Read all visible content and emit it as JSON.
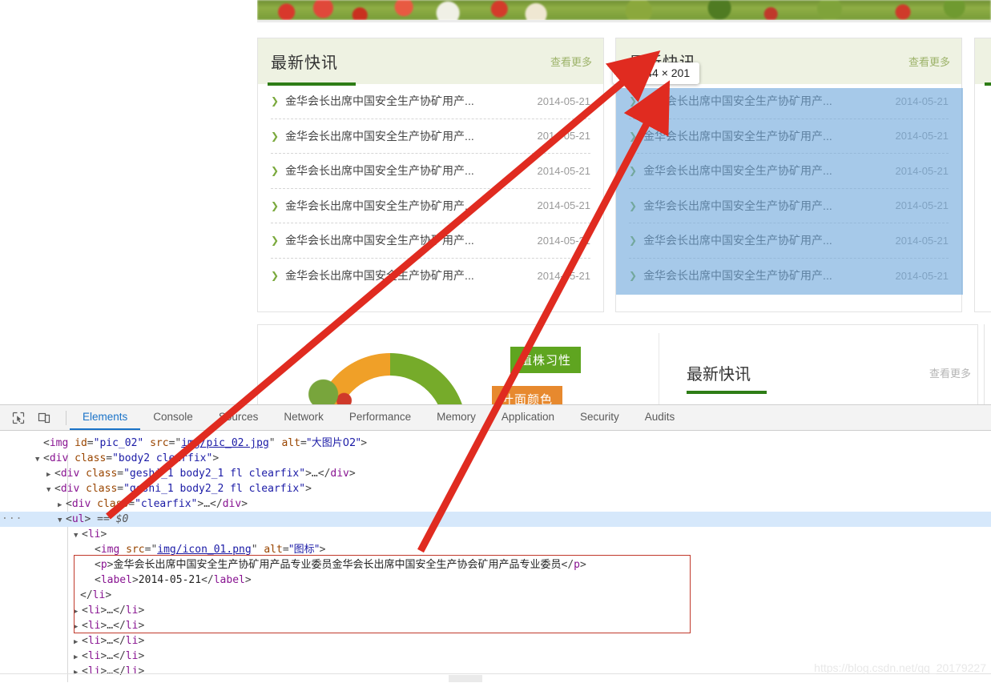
{
  "page": {
    "banner": {
      "alt": "大图片02"
    },
    "panels": [
      {
        "title": "最新快讯",
        "more": "查看更多",
        "rows": [
          {
            "text": "金华会长出席中国安全生产协矿用产...",
            "date": "2014-05-21"
          },
          {
            "text": "金华会长出席中国安全生产协矿用产...",
            "date": "2014-05-21"
          },
          {
            "text": "金华会长出席中国安全生产协矿用产...",
            "date": "2014-05-21"
          },
          {
            "text": "金华会长出席中国安全生产协矿用产...",
            "date": "2014-05-21"
          },
          {
            "text": "金华会长出席中国安全生产协矿用产...",
            "date": "2014-05-21"
          },
          {
            "text": "金华会长出席中国安全生产协矿用产...",
            "date": "2014-05-21"
          }
        ]
      },
      {
        "title": "最新快讯",
        "more": "查看更多",
        "rows": [
          {
            "text": "金华会长出席中国安全生产协矿用产...",
            "date": "2014-05-21"
          },
          {
            "text": "金华会长出席中国安全生产协矿用产...",
            "date": "2014-05-21"
          },
          {
            "text": "金华会长出席中国安全生产协矿用产...",
            "date": "2014-05-21"
          },
          {
            "text": "金华会长出席中国安全生产协矿用产...",
            "date": "2014-05-21"
          },
          {
            "text": "金华会长出席中国安全生产协矿用产...",
            "date": "2014-05-21"
          },
          {
            "text": "金华会长出席中国安全生产协矿用产...",
            "date": "2014-05-21"
          }
        ]
      }
    ],
    "lower": {
      "tag_green": "植株习性",
      "tag_orange": "叶面颜色",
      "mini_title": "最新快讯",
      "mini_more": "查看更多"
    },
    "highlight": {
      "tooltip_tag": "ul",
      "tooltip_dims": "344 × 201",
      "color": "#6fa8dc"
    }
  },
  "devtools": {
    "toolbar_icons": [
      "inspect-element-icon",
      "device-toolbar-icon"
    ],
    "tabs": [
      {
        "label": "Elements",
        "active": true
      },
      {
        "label": "Console",
        "active": false
      },
      {
        "label": "Sources",
        "active": false
      },
      {
        "label": "Network",
        "active": false
      },
      {
        "label": "Performance",
        "active": false
      },
      {
        "label": "Memory",
        "active": false
      },
      {
        "label": "Application",
        "active": false
      },
      {
        "label": "Security",
        "active": false
      },
      {
        "label": "Audits",
        "active": false
      }
    ],
    "dom": {
      "l1": {
        "tag": "img",
        "a1": "id",
        "v1": "\"pic_02\"",
        "a2": "src",
        "v2": "img/pic_02.jpg",
        "a3": "alt",
        "v3": "\"大图片02\""
      },
      "l2": {
        "class": "\"body2 clearfix\""
      },
      "l3": {
        "class": "\"geshi_1 body2_1 fl clearfix\""
      },
      "l4": {
        "class": "\"geshi_1 body2_2 fl clearfix\""
      },
      "l5": {
        "class": "\"clearfix\""
      },
      "selected": {
        "tag": "ul",
        "suffix": "== $0"
      },
      "li_img": {
        "a1": "src",
        "v1": "img/icon_01.png",
        "a2": "alt",
        "v2": "\"图标\""
      },
      "li_p": "金华会长出席中国安全生产协矿用产品专业委员金华会长出席中国安全生产协会矿用产品专业委员",
      "li_label": "2014-05-21",
      "collapsed_count": 5
    }
  },
  "watermark": "https://blog.csdn.net/qq_20179227"
}
